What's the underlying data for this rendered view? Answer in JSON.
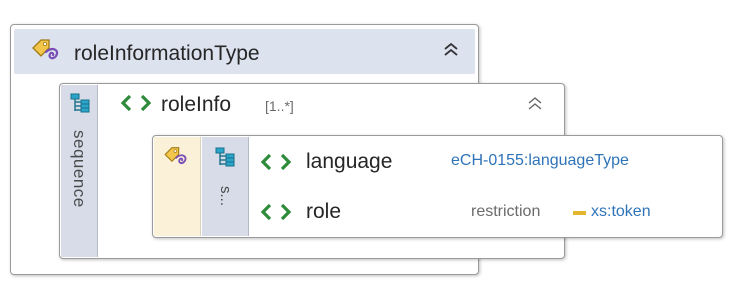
{
  "complex_type": {
    "name": "roleInformationType"
  },
  "element": {
    "name": "roleInfo",
    "cardinality": "[1..*]",
    "compositor_label": "sequence"
  },
  "inner_type": {
    "compositor_label": "s...",
    "children": [
      {
        "name": "language",
        "type": "eCH-0155:languageType"
      },
      {
        "name": "role",
        "derivation": "restriction",
        "base": "xs:token"
      }
    ]
  },
  "colors": {
    "header_bg": "#dde2ef",
    "compositor_strip": "#d7dce8",
    "type_strip": "#fbf1d9",
    "element_icon": "#2e8b3a",
    "type_link": "#2f73b8",
    "restriction_marker": "#e2b62d"
  },
  "icons": {
    "type": "complex-type-icon",
    "sequence": "sequence-icon",
    "element": "element-icon",
    "collapse": "collapse-chevrons-icon"
  }
}
